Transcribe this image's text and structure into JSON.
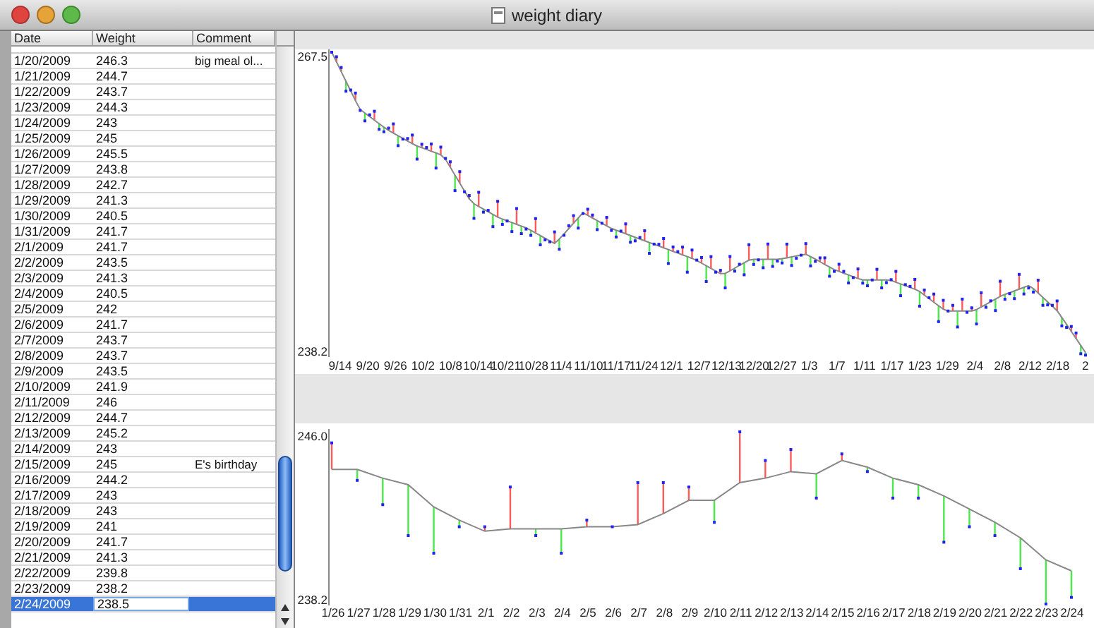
{
  "window": {
    "title": "weight diary"
  },
  "table": {
    "columns": [
      "Date",
      "Weight",
      "Comment"
    ],
    "rows": [
      {
        "date": "1/20/2009",
        "weight": "246.3",
        "comment": "big meal ol...",
        "selected": false
      },
      {
        "date": "1/21/2009",
        "weight": "244.7",
        "selected": false
      },
      {
        "date": "1/22/2009",
        "weight": "243.7",
        "selected": false
      },
      {
        "date": "1/23/2009",
        "weight": "244.3",
        "selected": false
      },
      {
        "date": "1/24/2009",
        "weight": "243",
        "selected": false
      },
      {
        "date": "1/25/2009",
        "weight": "245",
        "selected": false
      },
      {
        "date": "1/26/2009",
        "weight": "245.5",
        "selected": false
      },
      {
        "date": "1/27/2009",
        "weight": "243.8",
        "selected": false
      },
      {
        "date": "1/28/2009",
        "weight": "242.7",
        "selected": false
      },
      {
        "date": "1/29/2009",
        "weight": "241.3",
        "selected": false
      },
      {
        "date": "1/30/2009",
        "weight": "240.5",
        "selected": false
      },
      {
        "date": "1/31/2009",
        "weight": "241.7",
        "selected": false
      },
      {
        "date": "2/1/2009",
        "weight": "241.7",
        "selected": false
      },
      {
        "date": "2/2/2009",
        "weight": "243.5",
        "selected": false
      },
      {
        "date": "2/3/2009",
        "weight": "241.3",
        "selected": false
      },
      {
        "date": "2/4/2009",
        "weight": "240.5",
        "selected": false
      },
      {
        "date": "2/5/2009",
        "weight": "242",
        "selected": false
      },
      {
        "date": "2/6/2009",
        "weight": "241.7",
        "selected": false
      },
      {
        "date": "2/7/2009",
        "weight": "243.7",
        "selected": false
      },
      {
        "date": "2/8/2009",
        "weight": "243.7",
        "selected": false
      },
      {
        "date": "2/9/2009",
        "weight": "243.5",
        "selected": false
      },
      {
        "date": "2/10/2009",
        "weight": "241.9",
        "selected": false
      },
      {
        "date": "2/11/2009",
        "weight": "246",
        "selected": false
      },
      {
        "date": "2/12/2009",
        "weight": "244.7",
        "selected": false
      },
      {
        "date": "2/13/2009",
        "weight": "245.2",
        "selected": false
      },
      {
        "date": "2/14/2009",
        "weight": "243",
        "selected": false
      },
      {
        "date": "2/15/2009",
        "weight": "245",
        "comment": "E's birthday",
        "selected": false
      },
      {
        "date": "2/16/2009",
        "weight": "244.2",
        "selected": false
      },
      {
        "date": "2/17/2009",
        "weight": "243",
        "selected": false
      },
      {
        "date": "2/18/2009",
        "weight": "243",
        "selected": false
      },
      {
        "date": "2/19/2009",
        "weight": "241",
        "selected": false
      },
      {
        "date": "2/20/2009",
        "weight": "241.7",
        "selected": false
      },
      {
        "date": "2/21/2009",
        "weight": "241.3",
        "selected": false
      },
      {
        "date": "2/22/2009",
        "weight": "239.8",
        "selected": false
      },
      {
        "date": "2/23/2009",
        "weight": "238.2",
        "selected": false
      },
      {
        "date": "2/24/2009",
        "weight": "238.5",
        "selected": true
      }
    ]
  },
  "overview_chart": {
    "y_labels": [
      "267.5",
      "238.2"
    ],
    "x_labels": [
      "9/14",
      "9/20",
      "9/26",
      "10/2",
      "10/8",
      "10/14",
      "10/21",
      "10/28",
      "11/4",
      "11/10",
      "11/17",
      "11/24",
      "12/1",
      "12/7",
      "12/13",
      "12/20",
      "12/27",
      "1/3",
      "1/7",
      "1/11",
      "1/17",
      "1/23",
      "1/29",
      "2/4",
      "2/8",
      "2/12",
      "2/18",
      "2"
    ]
  },
  "detail_chart": {
    "y_labels": [
      "246.0",
      "238.2"
    ],
    "x_labels": [
      "1/26",
      "1/27",
      "1/28",
      "1/29",
      "1/30",
      "1/31",
      "2/1",
      "2/2",
      "2/3",
      "2/4",
      "2/5",
      "2/6",
      "2/7",
      "2/8",
      "2/9",
      "2/10",
      "2/11",
      "2/12",
      "2/13",
      "2/14",
      "2/15",
      "2/16",
      "2/17",
      "2/18",
      "2/19",
      "2/20",
      "2/21",
      "2/22",
      "2/23",
      "2/24"
    ]
  }
}
